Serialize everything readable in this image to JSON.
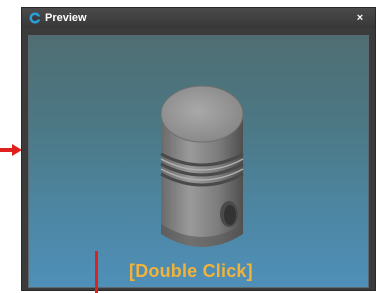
{
  "window": {
    "title": "Preview",
    "close_label": "×"
  },
  "viewport": {
    "hint_text": "[Double Click]"
  },
  "icons": {
    "app": "app-logo-icon",
    "close": "close-icon",
    "pointer_arrow": "arrow-right-icon"
  },
  "colors": {
    "hint": "#f2b33a",
    "annotation": "#e0201c",
    "titlebar": "#3b3b3b"
  }
}
